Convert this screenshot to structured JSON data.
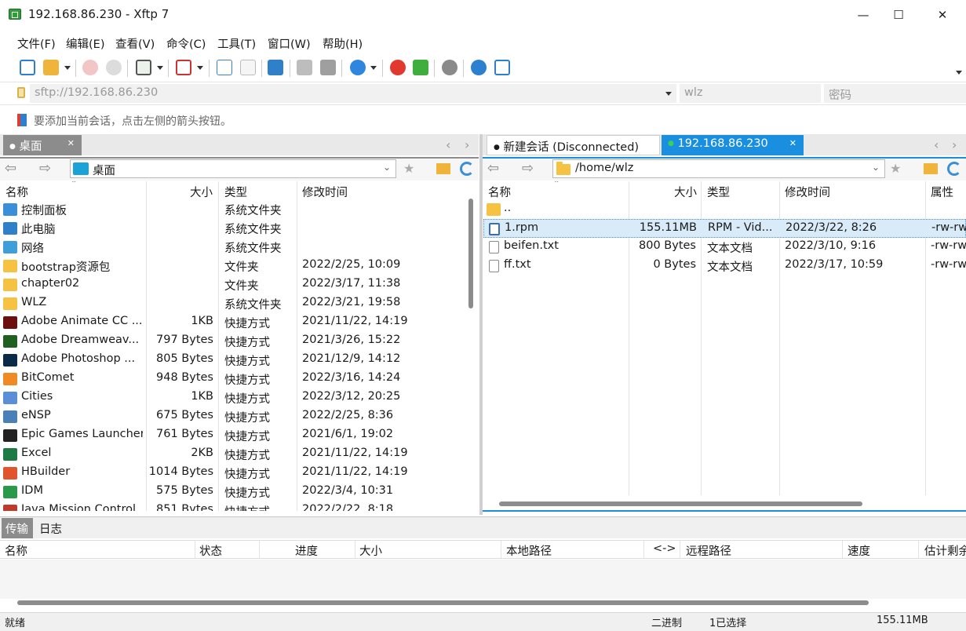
{
  "window": {
    "title": "192.168.86.230 - Xftp 7",
    "minimize": "—",
    "maximize": "☐",
    "close": "✕"
  },
  "menu": [
    "文件(F)",
    "编辑(E)",
    "查看(V)",
    "命令(C)",
    "工具(T)",
    "窗口(W)",
    "帮助(H)"
  ],
  "address": {
    "url": "sftp://192.168.86.230",
    "user": "wlz",
    "password_placeholder": "密码"
  },
  "hint": "要添加当前会话，点击左侧的箭头按钮。",
  "left": {
    "tab": "桌面",
    "path": "桌面",
    "columns": [
      "名称",
      "大小",
      "类型",
      "修改时间"
    ],
    "rows": [
      {
        "name": "控制面板",
        "size": "",
        "type": "系统文件夹",
        "mtime": "",
        "icon": "control-panel-icon",
        "color": "#3a8fd8"
      },
      {
        "name": "此电脑",
        "size": "",
        "type": "系统文件夹",
        "mtime": "",
        "icon": "computer-icon",
        "color": "#2f7fc9"
      },
      {
        "name": "网络",
        "size": "",
        "type": "系统文件夹",
        "mtime": "",
        "icon": "network-icon",
        "color": "#3f9fd8"
      },
      {
        "name": "bootstrap资源包",
        "size": "",
        "type": "文件夹",
        "mtime": "2022/2/25, 10:09",
        "icon": "folder-icon",
        "color": "#f5c242"
      },
      {
        "name": "chapter02",
        "size": "",
        "type": "文件夹",
        "mtime": "2022/3/17, 11:38",
        "icon": "folder-icon",
        "color": "#f5c242"
      },
      {
        "name": "WLZ",
        "size": "",
        "type": "系统文件夹",
        "mtime": "2022/3/21, 19:58",
        "icon": "folder-icon",
        "color": "#f5c242"
      },
      {
        "name": "Adobe Animate CC ...",
        "size": "1KB",
        "type": "快捷方式",
        "mtime": "2021/11/22, 14:19",
        "icon": "adobe-animate-icon",
        "color": "#6b0f0f"
      },
      {
        "name": "Adobe Dreamweav...",
        "size": "797 Bytes",
        "type": "快捷方式",
        "mtime": "2021/3/26, 15:22",
        "icon": "adobe-dreamweaver-icon",
        "color": "#1f5f1f"
      },
      {
        "name": "Adobe Photoshop ...",
        "size": "805 Bytes",
        "type": "快捷方式",
        "mtime": "2021/12/9, 14:12",
        "icon": "adobe-photoshop-icon",
        "color": "#0b2a4a"
      },
      {
        "name": "BitComet",
        "size": "948 Bytes",
        "type": "快捷方式",
        "mtime": "2022/3/16, 14:24",
        "icon": "bitcomet-icon",
        "color": "#f08a24"
      },
      {
        "name": "Cities",
        "size": "1KB",
        "type": "快捷方式",
        "mtime": "2022/3/12, 20:25",
        "icon": "cities-icon",
        "color": "#5a8fd8"
      },
      {
        "name": "eNSP",
        "size": "675 Bytes",
        "type": "快捷方式",
        "mtime": "2022/2/25, 8:36",
        "icon": "ensp-icon",
        "color": "#4a7fb8"
      },
      {
        "name": "Epic Games Launcher",
        "size": "761 Bytes",
        "type": "快捷方式",
        "mtime": "2021/6/1, 19:02",
        "icon": "epic-games-icon",
        "color": "#222222"
      },
      {
        "name": "Excel",
        "size": "2KB",
        "type": "快捷方式",
        "mtime": "2021/11/22, 14:19",
        "icon": "excel-icon",
        "color": "#1d7a44"
      },
      {
        "name": "HBuilder",
        "size": "1014 Bytes",
        "type": "快捷方式",
        "mtime": "2021/11/22, 14:19",
        "icon": "hbuilder-icon",
        "color": "#e0542e"
      },
      {
        "name": "IDM",
        "size": "575 Bytes",
        "type": "快捷方式",
        "mtime": "2022/3/4, 10:31",
        "icon": "idm-icon",
        "color": "#2a9a4a"
      },
      {
        "name": "Java Mission Control",
        "size": "851 Bytes",
        "type": "快捷方式",
        "mtime": "2022/2/22, 8:18",
        "icon": "java-icon",
        "color": "#c0392b"
      }
    ]
  },
  "right": {
    "tabs": [
      {
        "label": "新建会话 (Disconnected)"
      },
      {
        "label": "192.168.86.230"
      }
    ],
    "path": "/home/wlz",
    "columns": [
      "名称",
      "大小",
      "类型",
      "修改时间",
      "属性"
    ],
    "rows": [
      {
        "name": "..",
        "size": "",
        "type": "",
        "mtime": "",
        "attr": "",
        "icon": "folder-up-icon",
        "color": "#f5c242"
      },
      {
        "name": "1.rpm",
        "size": "155.11MB",
        "type": "RPM - Vid...",
        "mtime": "2022/3/22, 8:26",
        "attr": "-rw-rw",
        "icon": "video-file-icon",
        "color": "#3c6fa8"
      },
      {
        "name": "beifen.txt",
        "size": "800 Bytes",
        "type": "文本文档",
        "mtime": "2022/3/10, 9:16",
        "attr": "-rw-rw",
        "icon": "text-file-icon",
        "color": "#888888"
      },
      {
        "name": "ff.txt",
        "size": "0 Bytes",
        "type": "文本文档",
        "mtime": "2022/3/17, 10:59",
        "attr": "-rw-rw",
        "icon": "text-file-icon",
        "color": "#888888"
      }
    ]
  },
  "bottom": {
    "tabs": [
      "传输",
      "日志"
    ],
    "columns": [
      "名称",
      "状态",
      "进度",
      "大小",
      "本地路径",
      "<->",
      "远程路径",
      "速度",
      "估计剩余"
    ]
  },
  "status": {
    "ready": "就绪",
    "mode": "二进制",
    "selection": "1已选择",
    "size": "155.11MB"
  },
  "colors": {
    "accent": "#1a8fe0",
    "selection": "#d9ebf8",
    "connected_dot": "#3ad35a"
  }
}
